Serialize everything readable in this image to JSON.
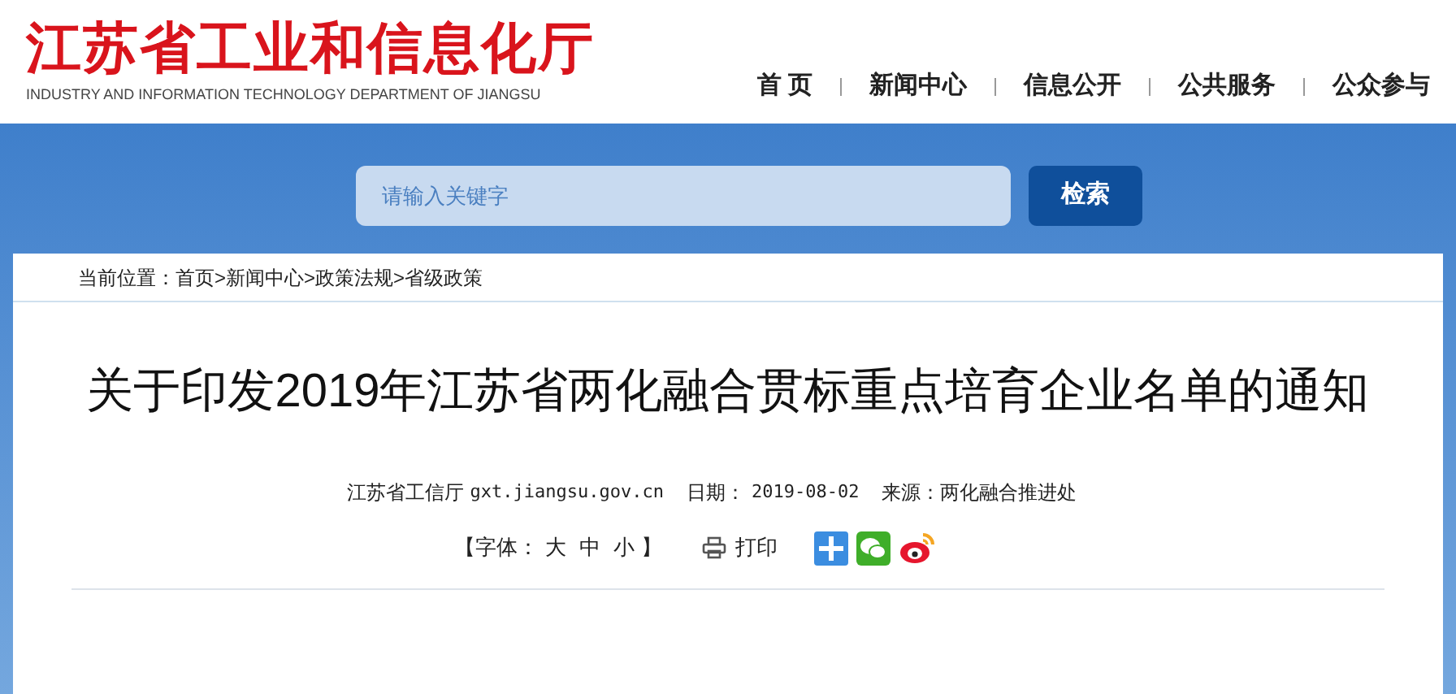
{
  "header": {
    "title": "江苏省工业和信息化厅",
    "subtitle": "INDUSTRY AND INFORMATION TECHNOLOGY DEPARTMENT OF JIANGSU"
  },
  "nav": [
    {
      "label": "首 页"
    },
    {
      "label": "新闻中心"
    },
    {
      "label": "信息公开"
    },
    {
      "label": "公共服务"
    },
    {
      "label": "公众参与"
    }
  ],
  "search": {
    "placeholder": "请输入关键字",
    "button": "检索"
  },
  "breadcrumb": {
    "label": "当前位置：",
    "separator": ">",
    "items": [
      "首页",
      "新闻中心",
      "政策法规",
      "省级政策"
    ]
  },
  "article": {
    "title": "关于印发2019年江苏省两化融合贯标重点培育企业名单的通知",
    "meta": [
      {
        "kind": "text",
        "text": "江苏省工信厅"
      },
      {
        "kind": "mono",
        "text": "gxt.jiangsu.gov.cn"
      },
      {
        "kind": "text",
        "text": "日期："
      },
      {
        "kind": "mono",
        "text": "2019-08-02"
      },
      {
        "kind": "text",
        "text": "来源：两化融合推进处"
      }
    ],
    "font_size": {
      "open": "【字体：",
      "options": [
        "大",
        "中",
        "小"
      ],
      "close": "】"
    },
    "print": "打印",
    "share": [
      {
        "kind": "plus"
      },
      {
        "kind": "wechat"
      },
      {
        "kind": "weibo"
      }
    ]
  }
}
